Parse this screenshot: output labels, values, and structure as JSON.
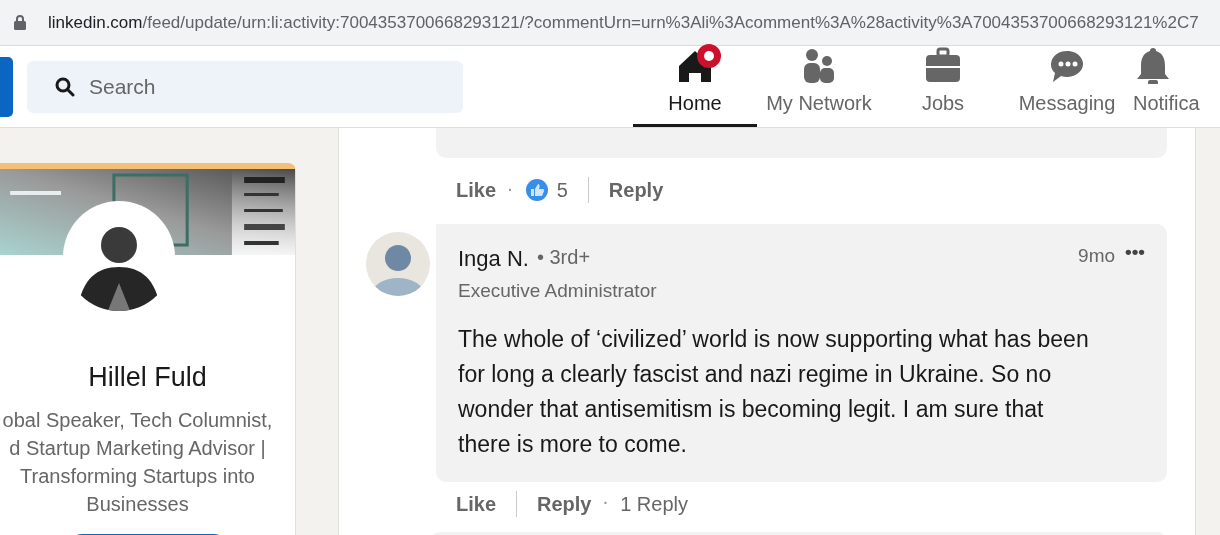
{
  "address_bar": {
    "host": "linkedin.com",
    "path": "/feed/update/urn:li:activity:7004353700668293121/?commentUrn=urn%3Ali%3Acomment%3A%28activity%3A7004353700668293121%2C7"
  },
  "search": {
    "placeholder": "Search"
  },
  "nav": [
    {
      "label": "Home",
      "kind": "home",
      "selected": true,
      "notification": true
    },
    {
      "label": "My Network",
      "kind": "network",
      "selected": false,
      "notification": false
    },
    {
      "label": "Jobs",
      "kind": "jobs",
      "selected": false,
      "notification": false
    },
    {
      "label": "Messaging",
      "kind": "messaging",
      "selected": false,
      "notification": false
    },
    {
      "label": "Notifica",
      "kind": "bell",
      "selected": false,
      "notification": false
    }
  ],
  "profile": {
    "name": "Hillel Fuld",
    "headline_lines": [
      "obal Speaker, Tech Columnist,",
      "d Startup Marketing Advisor |",
      "Transforming Startups into",
      "Businesses"
    ]
  },
  "comments": [
    {
      "kind": "cut",
      "actions": [
        {
          "kind": "like",
          "label": "Like"
        },
        {
          "kind": "dot",
          "label": "·"
        },
        {
          "kind": "reactions",
          "label": "5"
        },
        {
          "kind": "reply",
          "label": "Reply"
        }
      ]
    },
    {
      "kind": "full",
      "author": "Inga N.",
      "degree": "• 3rd+",
      "title": "Executive Administrator",
      "time": "9mo",
      "menu": "•••",
      "text": "The whole of ‘civilized’ world is now supporting what has been for long a clearly fascist and nazi regime in Ukraine. So no wonder that antisemitism is becoming legit. I am sure that there is more to come.",
      "actions": [
        {
          "kind": "like",
          "label": "Like"
        },
        {
          "kind": "reply",
          "label": "Reply"
        },
        {
          "kind": "dot",
          "label": "·"
        },
        {
          "kind": "replies",
          "label": "1 Reply"
        }
      ]
    }
  ]
}
